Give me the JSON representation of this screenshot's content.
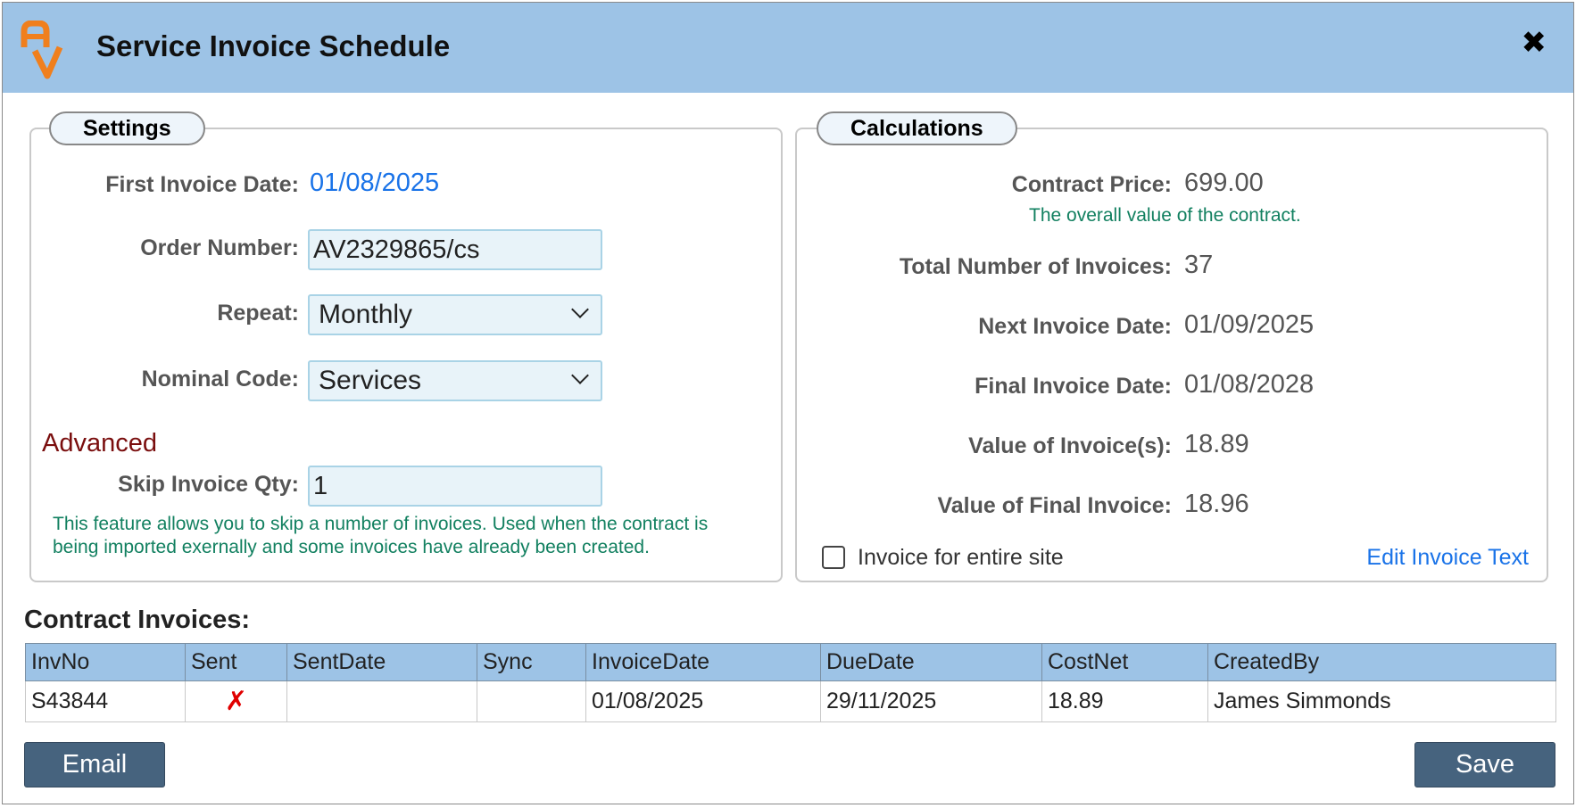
{
  "dialog": {
    "title": "Service Invoice Schedule",
    "close_glyph": "✖",
    "logo_icon": "av-logo"
  },
  "settings": {
    "legend": "Settings",
    "first_invoice_date_label": "First Invoice Date:",
    "first_invoice_date": "01/08/2025",
    "order_number_label": "Order Number:",
    "order_number": "AV2329865/cs",
    "repeat_label": "Repeat:",
    "repeat_value": "Monthly",
    "nominal_code_label": "Nominal Code:",
    "nominal_code_value": "Services",
    "advanced_heading": "Advanced",
    "skip_invoice_qty_label": "Skip Invoice Qty:",
    "skip_invoice_qty": "1",
    "skip_hint": "This feature allows you to skip a number of invoices. Used when the contract is being imported exernally and some invoices have already been created."
  },
  "calculations": {
    "legend": "Calculations",
    "contract_price_label": "Contract Price:",
    "contract_price": "699.00",
    "contract_price_hint": "The overall value of the contract.",
    "total_invoices_label": "Total Number of Invoices:",
    "total_invoices": "37",
    "next_invoice_date_label": "Next Invoice Date:",
    "next_invoice_date": "01/09/2025",
    "final_invoice_date_label": "Final Invoice Date:",
    "final_invoice_date": "01/08/2028",
    "value_of_invoices_label": "Value of Invoice(s):",
    "value_of_invoices": "18.89",
    "value_of_final_invoice_label": "Value of Final Invoice:",
    "value_of_final_invoice": "18.96",
    "entire_site_label": "Invoice for entire site",
    "entire_site_checked": false,
    "edit_invoice_text_link": "Edit Invoice Text"
  },
  "invoices": {
    "heading": "Contract Invoices:",
    "columns": [
      "InvNo",
      "Sent",
      "SentDate",
      "Sync",
      "InvoiceDate",
      "DueDate",
      "CostNet",
      "CreatedBy"
    ],
    "rows": [
      {
        "InvNo": "S43844",
        "Sent": "✗",
        "SentDate": "",
        "Sync": "",
        "InvoiceDate": "01/08/2025",
        "DueDate": "29/11/2025",
        "CostNet": "18.89",
        "CreatedBy": "James Simmonds"
      }
    ]
  },
  "buttons": {
    "email": "Email",
    "save": "Save"
  },
  "colors": {
    "titlebar": "#9dc3e6",
    "link_blue": "#1a73e8",
    "hint_green": "#128060",
    "advanced_red": "#7a0e0e",
    "button": "#46637e",
    "logo_orange": "#f07f1d"
  }
}
